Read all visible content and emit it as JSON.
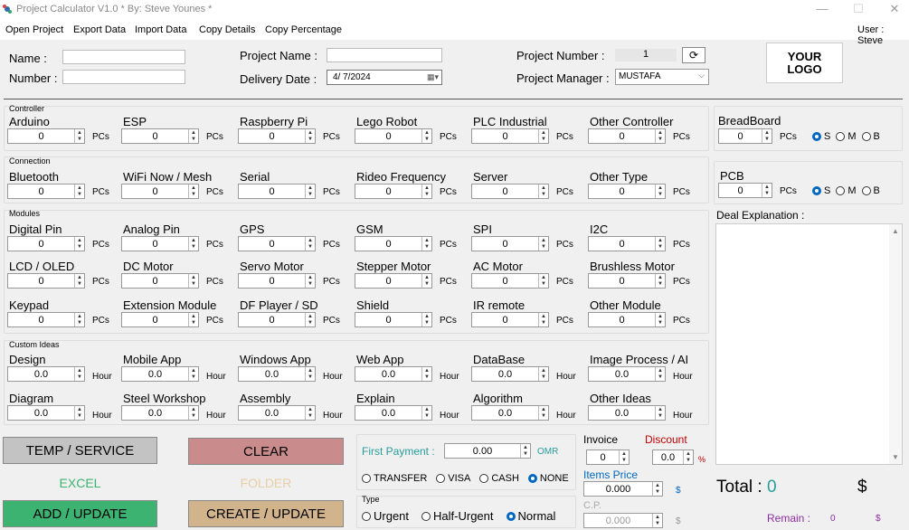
{
  "window": {
    "title": "Project Calculator V1.0 * By: Steve Younes *",
    "min": "—",
    "max": "☐",
    "close": "✕"
  },
  "menu": {
    "open": "Open Project",
    "export": "Export Data",
    "import": "Import Data",
    "copy_details": "Copy Details",
    "copy_percentage": "Copy Percentage",
    "user": "User : Steve"
  },
  "header": {
    "name_label": "Name :",
    "number_label": "Number :",
    "project_name_label": "Project Name :",
    "delivery_label": "Delivery Date :",
    "delivery_value": "4/ 7/2024",
    "project_number_label": "Project Number :",
    "project_number_value": "1",
    "manager_label": "Project Manager :",
    "manager_value": "MUSTAFA",
    "logo": "YOUR\nLOGO"
  },
  "units": {
    "pcs": "PCs",
    "hour": "Hour"
  },
  "controller": {
    "title": "Controller",
    "items": [
      {
        "label": "Arduino",
        "value": "0"
      },
      {
        "label": "ESP",
        "value": "0"
      },
      {
        "label": "Raspberry Pi",
        "value": "0"
      },
      {
        "label": "Lego Robot",
        "value": "0"
      },
      {
        "label": "PLC Industrial",
        "value": "0"
      },
      {
        "label": "Other Controller",
        "value": "0"
      }
    ]
  },
  "connection": {
    "title": "Connection",
    "items": [
      {
        "label": "Bluetooth",
        "value": "0"
      },
      {
        "label": "WiFi Now / Mesh",
        "value": "0"
      },
      {
        "label": "Serial",
        "value": "0"
      },
      {
        "label": "Rideo Frequency",
        "value": "0"
      },
      {
        "label": "Server",
        "value": "0"
      },
      {
        "label": "Other Type",
        "value": "0"
      }
    ]
  },
  "modules": {
    "title": "Modules",
    "row1": [
      {
        "label": "Digital Pin",
        "value": "0"
      },
      {
        "label": "Analog Pin",
        "value": "0"
      },
      {
        "label": "GPS",
        "value": "0"
      },
      {
        "label": "GSM",
        "value": "0"
      },
      {
        "label": "SPI",
        "value": "0"
      },
      {
        "label": "I2C",
        "value": "0"
      }
    ],
    "row2": [
      {
        "label": "LCD / OLED",
        "value": "0"
      },
      {
        "label": "DC Motor",
        "value": "0"
      },
      {
        "label": "Servo Motor",
        "value": "0"
      },
      {
        "label": "Stepper Motor",
        "value": "0"
      },
      {
        "label": "AC Motor",
        "value": "0"
      },
      {
        "label": "Brushless Motor",
        "value": "0"
      }
    ],
    "row3": [
      {
        "label": "Keypad",
        "value": "0"
      },
      {
        "label": "Extension Module",
        "value": "0"
      },
      {
        "label": "DF Player / SD",
        "value": "0"
      },
      {
        "label": "Shield",
        "value": "0"
      },
      {
        "label": "IR remote",
        "value": "0"
      },
      {
        "label": "Other Module",
        "value": "0"
      }
    ]
  },
  "custom": {
    "title": "Custom Ideas",
    "row1": [
      {
        "label": "Design",
        "value": "0.0"
      },
      {
        "label": "Mobile App",
        "value": "0.0"
      },
      {
        "label": "Windows App",
        "value": "0.0"
      },
      {
        "label": "Web App",
        "value": "0.0"
      },
      {
        "label": "DataBase",
        "value": "0.0"
      },
      {
        "label": "Image Process / AI",
        "value": "0.0"
      }
    ],
    "row2": [
      {
        "label": "Diagram",
        "value": "0.0"
      },
      {
        "label": "Steel Workshop",
        "value": "0.0"
      },
      {
        "label": "Assembly",
        "value": "0.0"
      },
      {
        "label": "Explain",
        "value": "0.0"
      },
      {
        "label": "Algorithm",
        "value": "0.0"
      },
      {
        "label": "Other Ideas",
        "value": "0.0"
      }
    ]
  },
  "breadboard": {
    "label": "BreadBoard",
    "value": "0",
    "opts": [
      "S",
      "M",
      "B"
    ]
  },
  "pcb": {
    "label": "PCB",
    "value": "0",
    "opts": [
      "S",
      "M",
      "B"
    ]
  },
  "deal": {
    "label": "Deal Explanation :"
  },
  "buttons": {
    "temp": "TEMP / SERVICE",
    "clear": "CLEAR",
    "excel": "EXCEL",
    "folder": "FOLDER",
    "add": "ADD / UPDATE",
    "create": "CREATE / UPDATE"
  },
  "payment": {
    "first_label": "First Payment :",
    "first_value": "0.00",
    "currency": "OMR",
    "methods": [
      "TRANSFER",
      "VISA",
      "CASH",
      "NONE"
    ],
    "type_title": "Type",
    "types": [
      "Urgent",
      "Half-Urgent",
      "Normal"
    ]
  },
  "pricing": {
    "invoice_label": "Invoice",
    "invoice_value": "0",
    "discount_label": "Discount",
    "discount_value": "0.0",
    "pct": "%",
    "items_price_label": "Items Price",
    "items_price_value": "0.000",
    "cp_label": "C.P.",
    "cp_value": "0.000",
    "dollar": "$"
  },
  "totals": {
    "total_label": "Total :",
    "total_value": "0",
    "total_currency": "$",
    "remain_label": "Remain :",
    "remain_value": "0",
    "remain_currency": "$"
  },
  "colors": {
    "temp": "#c3c3c3",
    "clear": "#c98b8b",
    "add": "#3cb371",
    "create": "#d2b48c",
    "excel": "#3cb371",
    "folder": "#e8cfa6",
    "teal": "#2a9d9d",
    "purple": "#8b2fa0",
    "red": "#c00000",
    "blue": "#0067c0"
  }
}
